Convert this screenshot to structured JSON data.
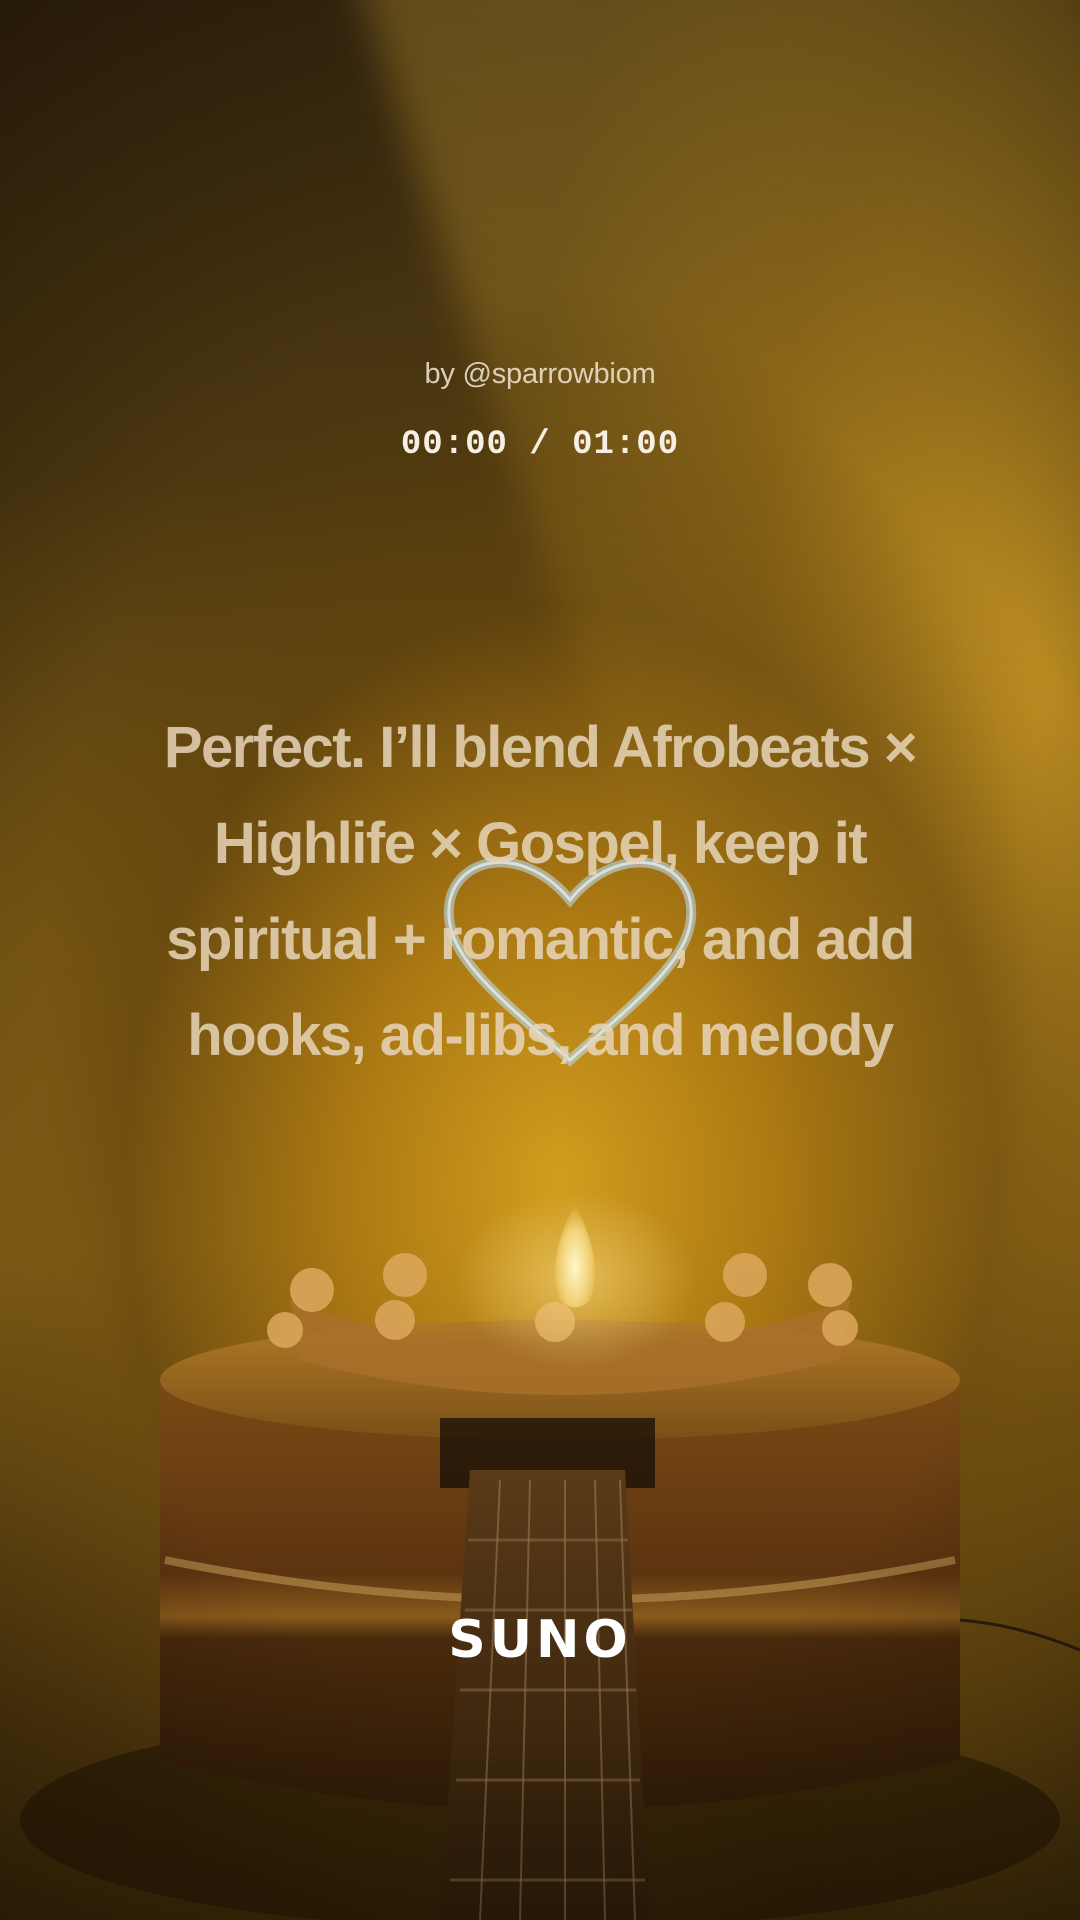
{
  "player": {
    "byline": "by @sparrowbiom",
    "time": "00:00 / 01:00",
    "lyric": "Perfect. I’ll blend Afrobeats × Highlife × Gospel, keep it spiritual + romantic, and add hooks, ad-libs, and melody"
  },
  "brand": {
    "logo": "SUNO"
  },
  "colors": {
    "accent": "#d6a01e",
    "text_primary": "#f6f0e4",
    "text_lyric": "#e8d6ba"
  },
  "icons": {
    "artwork": "guitar-cake-icon",
    "heart": "neon-heart-icon"
  }
}
